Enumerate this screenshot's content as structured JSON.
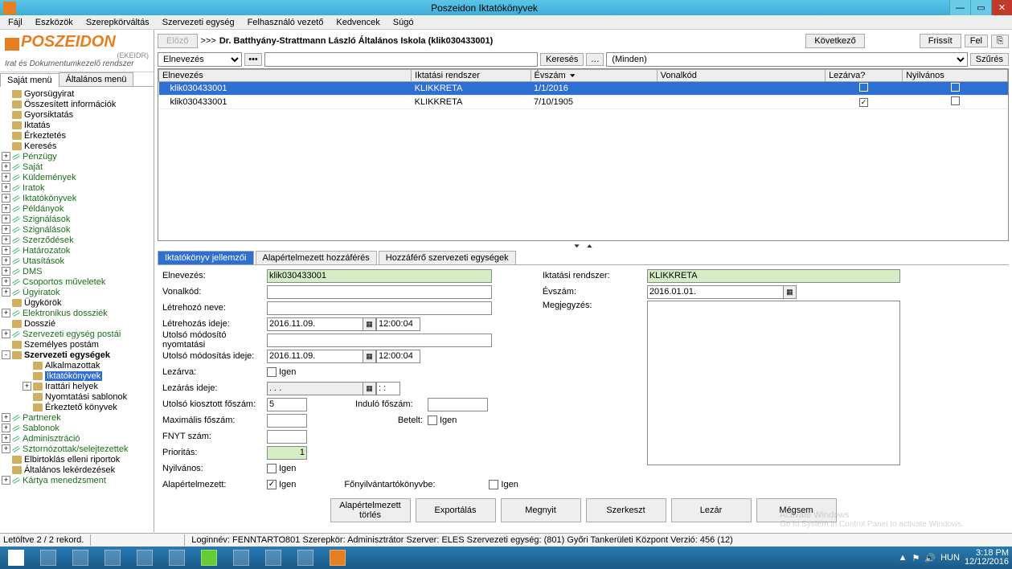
{
  "window": {
    "title": "Poszeidon Iktatókönyvek"
  },
  "menubar": [
    "Fájl",
    "Eszközök",
    "Szerepkörváltás",
    "Szervezeti egység",
    "Felhasználó vezető",
    "Kedvencek",
    "Súgó"
  ],
  "logo": {
    "brand": "POSZEIDON",
    "sub": "(EKEIDR)",
    "sub2": "Irat és Dokumentumkezelő rendszer"
  },
  "left_tabs": {
    "active": "Saját menü",
    "other": "Általános menü"
  },
  "tree": [
    {
      "l": 1,
      "exp": "",
      "lbl": "Gyorsügyirat"
    },
    {
      "l": 1,
      "exp": "",
      "lbl": "Összesített információk"
    },
    {
      "l": 1,
      "exp": "",
      "lbl": "Gyorsiktatás"
    },
    {
      "l": 1,
      "exp": "",
      "lbl": "Iktatás"
    },
    {
      "l": 1,
      "exp": "",
      "lbl": "Érkeztetés"
    },
    {
      "l": 1,
      "exp": "",
      "lbl": "Keresés"
    },
    {
      "l": 1,
      "exp": "+",
      "lbl": "Pénzügy",
      "link": true
    },
    {
      "l": 1,
      "exp": "+",
      "lbl": "Saját",
      "link": true
    },
    {
      "l": 1,
      "exp": "+",
      "lbl": "Küldemények",
      "link": true
    },
    {
      "l": 1,
      "exp": "+",
      "lbl": "Iratok",
      "link": true
    },
    {
      "l": 1,
      "exp": "+",
      "lbl": "Iktatókönyvek",
      "link": true
    },
    {
      "l": 1,
      "exp": "+",
      "lbl": "Példányok",
      "link": true
    },
    {
      "l": 1,
      "exp": "+",
      "lbl": "Szignálások",
      "link": true
    },
    {
      "l": 1,
      "exp": "+",
      "lbl": "Szignálások",
      "link": true
    },
    {
      "l": 1,
      "exp": "+",
      "lbl": "Szerződések",
      "link": true
    },
    {
      "l": 1,
      "exp": "+",
      "lbl": "Határozatok",
      "link": true
    },
    {
      "l": 1,
      "exp": "+",
      "lbl": "Utasítások",
      "link": true
    },
    {
      "l": 1,
      "exp": "+",
      "lbl": "DMS",
      "link": true
    },
    {
      "l": 1,
      "exp": "+",
      "lbl": "Csoportos műveletek",
      "link": true
    },
    {
      "l": 1,
      "exp": "+",
      "lbl": "Ügyiratok",
      "link": true
    },
    {
      "l": 1,
      "exp": "",
      "lbl": "Ügykörök"
    },
    {
      "l": 1,
      "exp": "+",
      "lbl": "Elektronikus dossziék",
      "link": true
    },
    {
      "l": 1,
      "exp": "",
      "lbl": "Dosszié"
    },
    {
      "l": 1,
      "exp": "+",
      "lbl": "Szervezeti egység postái",
      "link": true
    },
    {
      "l": 1,
      "exp": "",
      "lbl": "Személyes postám"
    },
    {
      "l": 1,
      "exp": "-",
      "lbl": "Szervezeti egységek",
      "bold": true
    },
    {
      "l": 2,
      "exp": "",
      "lbl": "Alkalmazottak"
    },
    {
      "l": 2,
      "exp": "",
      "lbl": "Iktatókönyvek",
      "sel": true
    },
    {
      "l": 2,
      "exp": "+",
      "lbl": "Irattári helyek"
    },
    {
      "l": 2,
      "exp": "",
      "lbl": "Nyomtatási sablonok"
    },
    {
      "l": 2,
      "exp": "",
      "lbl": "Érkeztető könyvek"
    },
    {
      "l": 1,
      "exp": "+",
      "lbl": "Partnerek",
      "link": true
    },
    {
      "l": 1,
      "exp": "+",
      "lbl": "Sablonok",
      "link": true
    },
    {
      "l": 1,
      "exp": "+",
      "lbl": "Adminisztráció",
      "link": true
    },
    {
      "l": 1,
      "exp": "+",
      "lbl": "Sztornózottak/selejtezettek",
      "link": true
    },
    {
      "l": 1,
      "exp": "",
      "lbl": "Elbirtoklás elleni riportok"
    },
    {
      "l": 1,
      "exp": "",
      "lbl": "Általános lekérdezések"
    },
    {
      "l": 1,
      "exp": "+",
      "lbl": "Kártya menedzsment",
      "link": true
    }
  ],
  "breadcrumb": {
    "prev": "Előző",
    "arrows": ">>>",
    "text": "Dr. Batthyány-Strattmann László Általános Iskola (klik030433001)",
    "next": "Következő",
    "refresh": "Frissít",
    "up": "Fel"
  },
  "search": {
    "field_select": "Elnevezés",
    "btn_search": "Keresés",
    "filter_all": "(Minden)",
    "btn_filter": "Szűrés"
  },
  "grid": {
    "cols": [
      "Elnevezés",
      "Iktatási rendszer",
      "Évszám",
      "Vonalkód",
      "Lezárva?",
      "Nyilvános"
    ],
    "rows": [
      {
        "en": "klik030433001",
        "ik": "KLIKKRETA",
        "ev": "1/1/2016",
        "vk": "",
        "lez": false,
        "ny": false,
        "sel": true
      },
      {
        "en": "klik030433001",
        "ik": "KLIKKRETA",
        "ev": "7/10/1905",
        "vk": "",
        "lez": true,
        "ny": false,
        "sel": false
      }
    ]
  },
  "detail_tabs": [
    "Iktatókönyv jellemzői",
    "Alapértelmezett hozzáférés",
    "Hozzáférő szervezeti egységek"
  ],
  "detail": {
    "elnevezes_lbl": "Elnevezés:",
    "elnevezes": "klik030433001",
    "vonalkod_lbl": "Vonalkód:",
    "vonalkod": "",
    "letrehozo_lbl": "Létrehozó neve:",
    "letrehozo": "",
    "letrehozas_lbl": "Létrehozás ideje:",
    "letrehozas_d": "2016.11.09.",
    "letrehozas_t": "12:00:04",
    "utmod_ny_lbl": "Utolsó módosító nyomtatási",
    "utmod_ny": "",
    "utmod_lbl": "Utolsó módosítás ideje:",
    "utmod_d": "2016.11.09.",
    "utmod_t": "12:00:04",
    "lezarva_lbl": "Lezárva:",
    "lezarva_chk": false,
    "igen": "Igen",
    "lezaras_lbl": "Lezárás ideje:",
    "lezaras_d": ". . .",
    "lezaras_t": ": :",
    "utkioszt_lbl": "Utolsó kiosztott főszám:",
    "utkioszt": "5",
    "indulo_lbl": "Induló főszám:",
    "indulo": "",
    "max_lbl": "Maximális főszám:",
    "max": "",
    "betelt_lbl": "Betelt:",
    "betelt_chk": false,
    "fnyt_lbl": "FNYT szám:",
    "fnyt": "",
    "prio_lbl": "Prioritás:",
    "prio": "1",
    "nyilv_lbl": "Nyilvános:",
    "nyilv_chk": false,
    "alap_lbl": "Alapértelmezett:",
    "alap_chk": true,
    "fonyilv_lbl": "Főnyilvántartókönyvbe:",
    "fonyilv_chk": false,
    "iktrend_lbl": "Iktatási rendszer:",
    "iktrend": "KLIKKRETA",
    "evszam_lbl": "Évszám:",
    "evszam": "2016.01.01.",
    "megj_lbl": "Megjegyzés:",
    "megj": ""
  },
  "buttons": {
    "alapdel": "Alapértelmezett törlés",
    "export": "Exportálás",
    "open": "Megnyit",
    "edit": "Szerkeszt",
    "close": "Lezár",
    "cancel": "Mégsem"
  },
  "status": {
    "left": "Letöltve 2 / 2 rekord.",
    "login": "Loginnév: FENNTARTO801  Szerepkör: Adminisztrátor  Szerver: ELES  Szervezeti egység: (801) Győri Tankerületi Központ  Verzió: 456 (12)"
  },
  "taskbar": {
    "lang": "HUN",
    "time": "3:18 PM",
    "date": "12/12/2016"
  },
  "watermark": {
    "l1": "Activate Windows",
    "l2": "Go to System in Control Panel to activate Windows."
  }
}
